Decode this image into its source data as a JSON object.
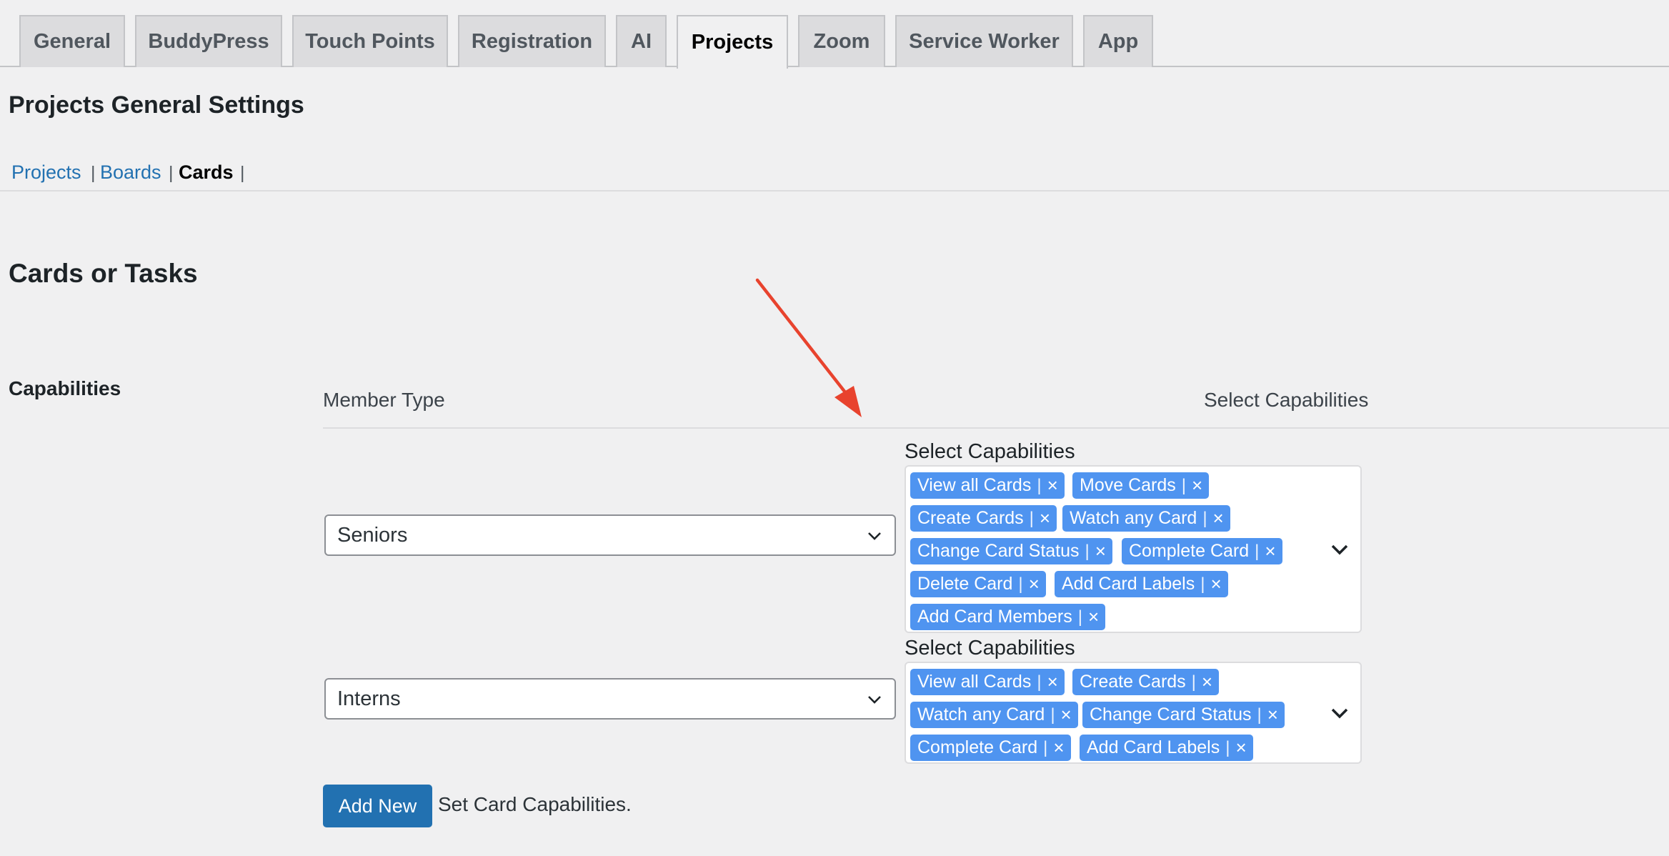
{
  "tabs": [
    {
      "label": "General"
    },
    {
      "label": "BuddyPress"
    },
    {
      "label": "Touch Points"
    },
    {
      "label": "Registration"
    },
    {
      "label": "AI"
    },
    {
      "label": "Projects",
      "active": true
    },
    {
      "label": "Zoom"
    },
    {
      "label": "Service Worker"
    },
    {
      "label": "App"
    }
  ],
  "page_title": "Projects General Settings",
  "subnav": {
    "items": [
      "Projects",
      "Boards",
      "Cards"
    ],
    "current": "Cards",
    "separator": "|"
  },
  "section_title": "Cards or Tasks",
  "row_label": "Capabilities",
  "table": {
    "col_member_type": "Member Type",
    "col_select_capabilities": "Select Capabilities"
  },
  "rows": [
    {
      "member_type": "Seniors",
      "capabilities_label": "Select Capabilities",
      "capabilities": [
        "View all Cards",
        "Move Cards",
        "Create Cards",
        "Watch any Card",
        "Change Card Status",
        "Complete Card",
        "Delete Card",
        "Add Card Labels",
        "Add Card Members"
      ]
    },
    {
      "member_type": "Interns",
      "capabilities_label": "Select Capabilities",
      "capabilities": [
        "View all Cards",
        "Create Cards",
        "Watch any Card",
        "Change Card Status",
        "Complete Card",
        "Add Card Labels"
      ]
    }
  ],
  "chip_separator": "|",
  "chip_remove": "×",
  "add_button": "Add New",
  "add_description": "Set Card Capabilities.",
  "colors": {
    "accent": "#2271b1",
    "chip": "#4f94f0",
    "annotation_arrow": "#e8432e"
  }
}
